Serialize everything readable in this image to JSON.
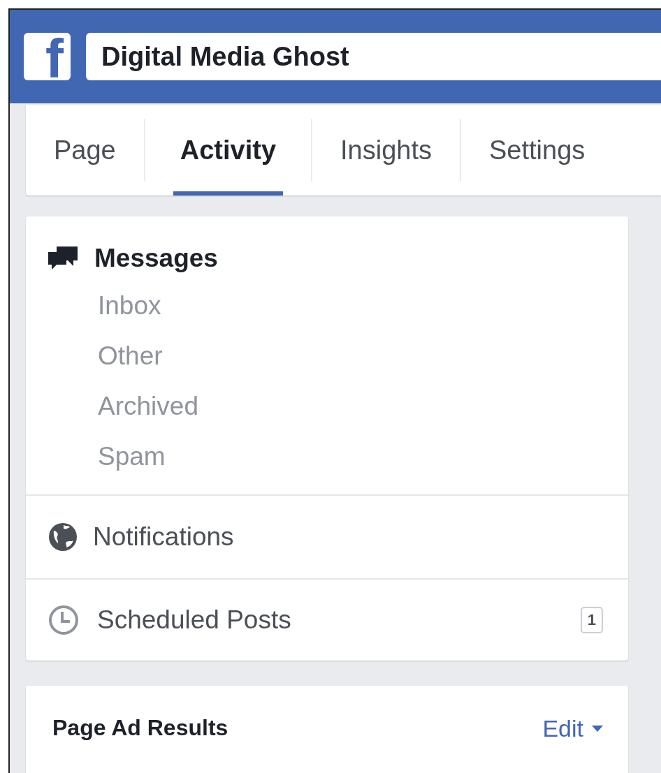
{
  "header": {
    "logo": "f",
    "search_value": "Digital Media Ghost"
  },
  "tabs": [
    {
      "label": "Page",
      "selected": false
    },
    {
      "label": "Activity",
      "selected": true
    },
    {
      "label": "Insights",
      "selected": false
    },
    {
      "label": "Settings",
      "selected": false
    }
  ],
  "messages": {
    "title": "Messages",
    "items": [
      "Inbox",
      "Other",
      "Archived",
      "Spam"
    ]
  },
  "notifications": {
    "label": "Notifications"
  },
  "scheduled_posts": {
    "label": "Scheduled Posts",
    "badge": "1"
  },
  "page_ad_results": {
    "title": "Page Ad Results",
    "edit": "Edit"
  }
}
